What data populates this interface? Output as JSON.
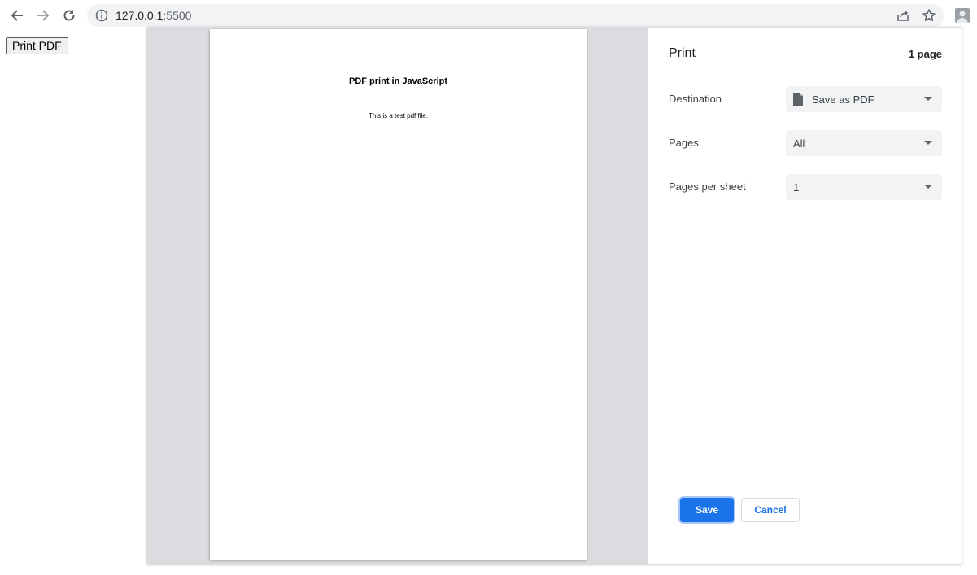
{
  "browser": {
    "url_host": "127.0.0.1",
    "url_port": ":5500"
  },
  "page": {
    "print_button_label": "Print PDF"
  },
  "print_dialog": {
    "title": "Print",
    "page_count": "1 page",
    "destination": {
      "label": "Destination",
      "value": "Save as PDF"
    },
    "pages": {
      "label": "Pages",
      "value": "All"
    },
    "pages_per_sheet": {
      "label": "Pages per sheet",
      "value": "1"
    },
    "save_label": "Save",
    "cancel_label": "Cancel",
    "preview": {
      "heading": "PDF print in JavaScript",
      "body": "This is a test pdf file."
    }
  },
  "colors": {
    "accent": "#1a73e8",
    "preview_bg": "#dadce0",
    "select_bg": "#f1f3f4"
  }
}
